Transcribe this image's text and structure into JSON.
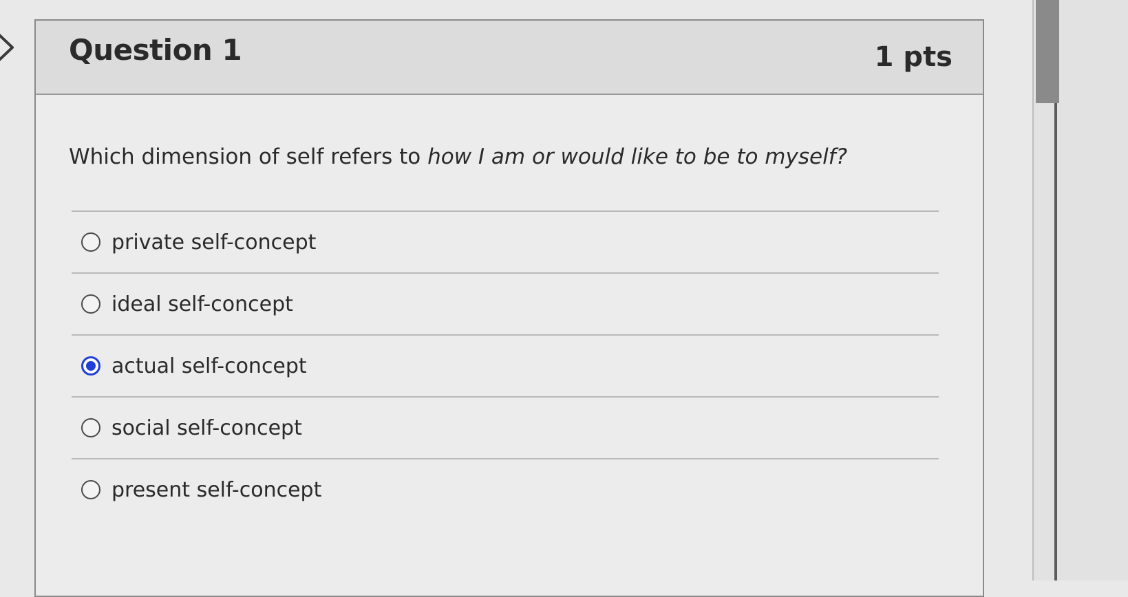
{
  "question": {
    "title": "Question 1",
    "points": "1 pts",
    "text_prefix": "Which dimension of self refers to ",
    "text_emphasis": "how I am or would like to be to myself?"
  },
  "answers": [
    {
      "label": "private self-concept",
      "selected": false
    },
    {
      "label": "ideal self-concept",
      "selected": false
    },
    {
      "label": "actual self-concept",
      "selected": true
    },
    {
      "label": "social self-concept",
      "selected": false
    },
    {
      "label": "present self-concept",
      "selected": false
    }
  ],
  "colors": {
    "selected_radio": "#1f3fd6",
    "header_background": "#dcdcdc"
  },
  "icons": {
    "nav": "chevron-right-icon"
  }
}
